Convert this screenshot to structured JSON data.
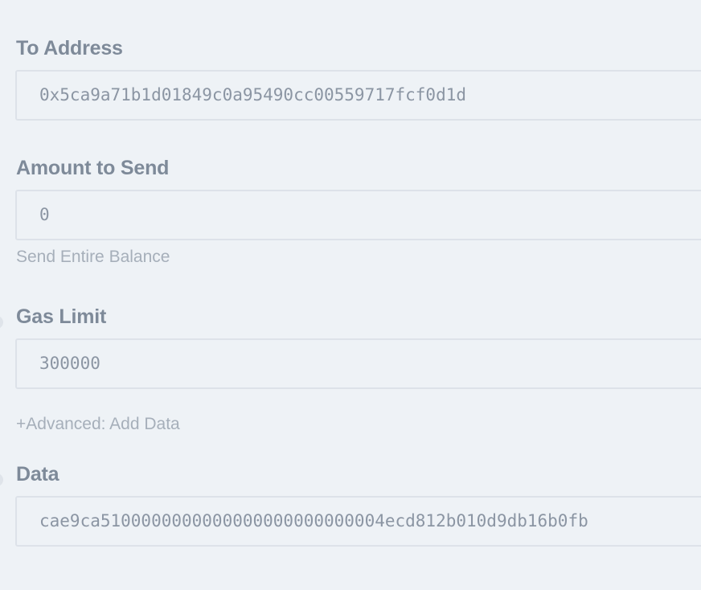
{
  "form": {
    "to_address": {
      "label": "To Address",
      "value": "0x5ca9a71b1d01849c0a95490cc00559717fcf0d1d"
    },
    "amount": {
      "label": "Amount to Send",
      "value": "0",
      "send_entire_balance": "Send Entire Balance"
    },
    "gas_limit": {
      "label": "Gas Limit",
      "value": "300000"
    },
    "advanced_link": "+Advanced: Add Data",
    "data": {
      "label": "Data",
      "value": "cae9ca5100000000000000000000000004ecd812b010d9db16b0fb"
    }
  },
  "colors": {
    "background": "#eef2f6",
    "label": "#7e8a99",
    "input_text": "#8b95a3",
    "link": "#a6afba",
    "border": "#dde2e9"
  }
}
